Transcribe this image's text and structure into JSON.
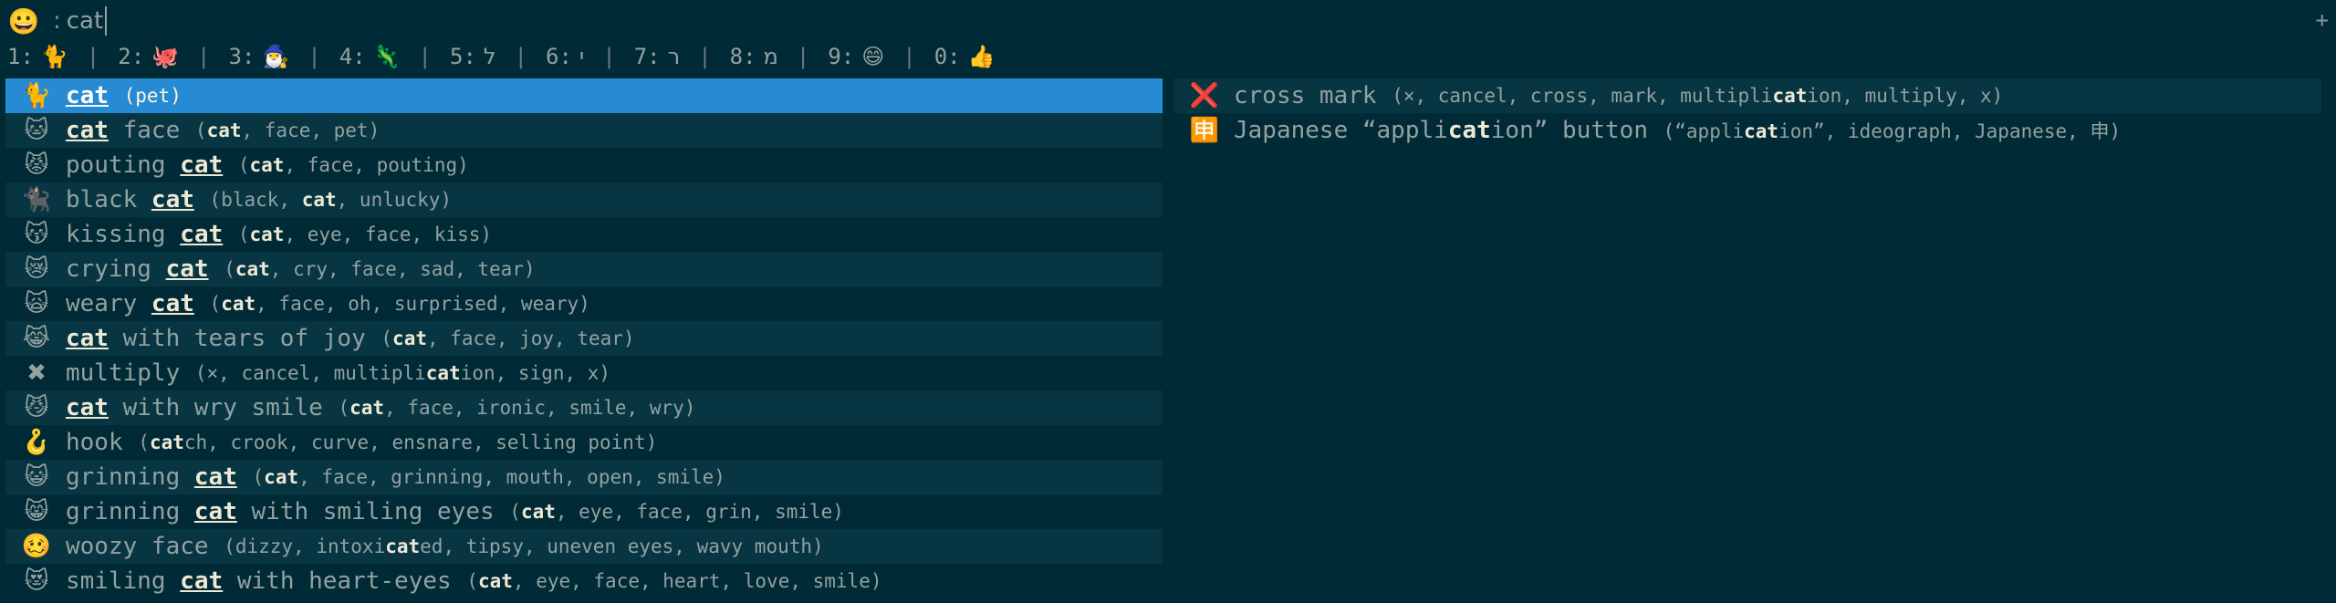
{
  "search": {
    "emoji": "😀",
    "prompt": ":",
    "value": "cat",
    "add_label": "+"
  },
  "recent": [
    {
      "key": "1:",
      "emoji": "🐈"
    },
    {
      "key": "2:",
      "emoji": "🐙"
    },
    {
      "key": "3:",
      "emoji": "🧙‍♂️"
    },
    {
      "key": "4:",
      "emoji": "🦎"
    },
    {
      "key": "5:",
      "emoji": "ל"
    },
    {
      "key": "6:",
      "emoji": "י"
    },
    {
      "key": "7:",
      "emoji": "ר"
    },
    {
      "key": "8:",
      "emoji": "מ"
    },
    {
      "key": "9:",
      "emoji": "😄"
    },
    {
      "key": "0:",
      "emoji": "👍"
    }
  ],
  "left_results": [
    {
      "icon": "🐈",
      "name_pre": "",
      "name_hl": "cat",
      "name_post": "",
      "tags": "(pet)",
      "selected": true,
      "alt": false
    },
    {
      "icon": "🐱",
      "name_pre": "",
      "name_hl": "cat",
      "name_post": " face",
      "tags_parts": [
        "(",
        "cat",
        ", face, pet)"
      ],
      "alt": true
    },
    {
      "icon": "😾",
      "name_pre": "pouting ",
      "name_hl": "cat",
      "name_post": "",
      "tags_parts": [
        "(",
        "cat",
        ", face, pouting)"
      ],
      "alt": false
    },
    {
      "icon": "🐈‍⬛",
      "name_pre": "black ",
      "name_hl": "cat",
      "name_post": "",
      "tags_parts": [
        "(black, ",
        "cat",
        ", unlucky)"
      ],
      "alt": true
    },
    {
      "icon": "😽",
      "name_pre": "kissing ",
      "name_hl": "cat",
      "name_post": "",
      "tags_parts": [
        "(",
        "cat",
        ", eye, face, kiss)"
      ],
      "alt": false
    },
    {
      "icon": "😿",
      "name_pre": "crying ",
      "name_hl": "cat",
      "name_post": "",
      "tags_parts": [
        "(",
        "cat",
        ", cry, face, sad, tear)"
      ],
      "alt": true
    },
    {
      "icon": "🙀",
      "name_pre": "weary ",
      "name_hl": "cat",
      "name_post": "",
      "tags_parts": [
        "(",
        "cat",
        ", face, oh, surprised, weary)"
      ],
      "alt": false
    },
    {
      "icon": "😹",
      "name_pre": "",
      "name_hl": "cat",
      "name_post": " with tears of joy",
      "tags_parts": [
        "(",
        "cat",
        ", face, joy, tear)"
      ],
      "alt": true
    },
    {
      "icon": "✖",
      "name_pre": "multiply",
      "name_hl": "",
      "name_post": "",
      "tags_parts": [
        "(×, cancel, multipli",
        "cat",
        "ion, sign, x)"
      ],
      "alt": false
    },
    {
      "icon": "😼",
      "name_pre": "",
      "name_hl": "cat",
      "name_post": " with wry smile",
      "tags_parts": [
        "(",
        "cat",
        ", face, ironic, smile, wry)"
      ],
      "alt": true
    },
    {
      "icon": "🪝",
      "name_pre": "hook",
      "name_hl": "",
      "name_post": "",
      "tags_parts": [
        "(",
        "cat",
        "ch, crook, curve, ensnare, selling point)"
      ],
      "alt": false
    },
    {
      "icon": "😺",
      "name_pre": "grinning ",
      "name_hl": "cat",
      "name_post": "",
      "tags_parts": [
        "(",
        "cat",
        ", face, grinning, mouth, open, smile)"
      ],
      "alt": true
    },
    {
      "icon": "😸",
      "name_pre": "grinning ",
      "name_hl": "cat",
      "name_post": " with smiling eyes",
      "tags_parts": [
        "(",
        "cat",
        ", eye, face, grin, smile)"
      ],
      "alt": false
    },
    {
      "icon": "🥴",
      "name_pre": "woozy face",
      "name_hl": "",
      "name_post": "",
      "tags_parts": [
        "(dizzy, intoxi",
        "cat",
        "ed, tipsy, uneven eyes, wavy mouth)"
      ],
      "alt": true
    },
    {
      "icon": "😻",
      "name_pre": "smiling ",
      "name_hl": "cat",
      "name_post": " with heart-eyes",
      "tags_parts": [
        "(",
        "cat",
        ", eye, face, heart, love, smile)"
      ],
      "alt": false
    }
  ],
  "right_results": [
    {
      "icon": "❌",
      "name_pre": "cross mark",
      "name_hl": "",
      "name_post": "",
      "tags_parts": [
        "(×, cancel, cross, mark, multipli",
        "cat",
        "ion, multiply, x)"
      ],
      "alt": true
    },
    {
      "icon": "🈸",
      "name_pre": "Japanese “appli",
      "name_bold": "cat",
      "name_post": "ion” button",
      "tags_parts": [
        "(“appli",
        "cat",
        "ion”, ideograph, Japanese, 申)"
      ],
      "alt": false
    }
  ],
  "colors": {
    "background": "#002b36",
    "row_alt": "#073642",
    "selected": "#268bd2",
    "text": "#93a1a1"
  }
}
